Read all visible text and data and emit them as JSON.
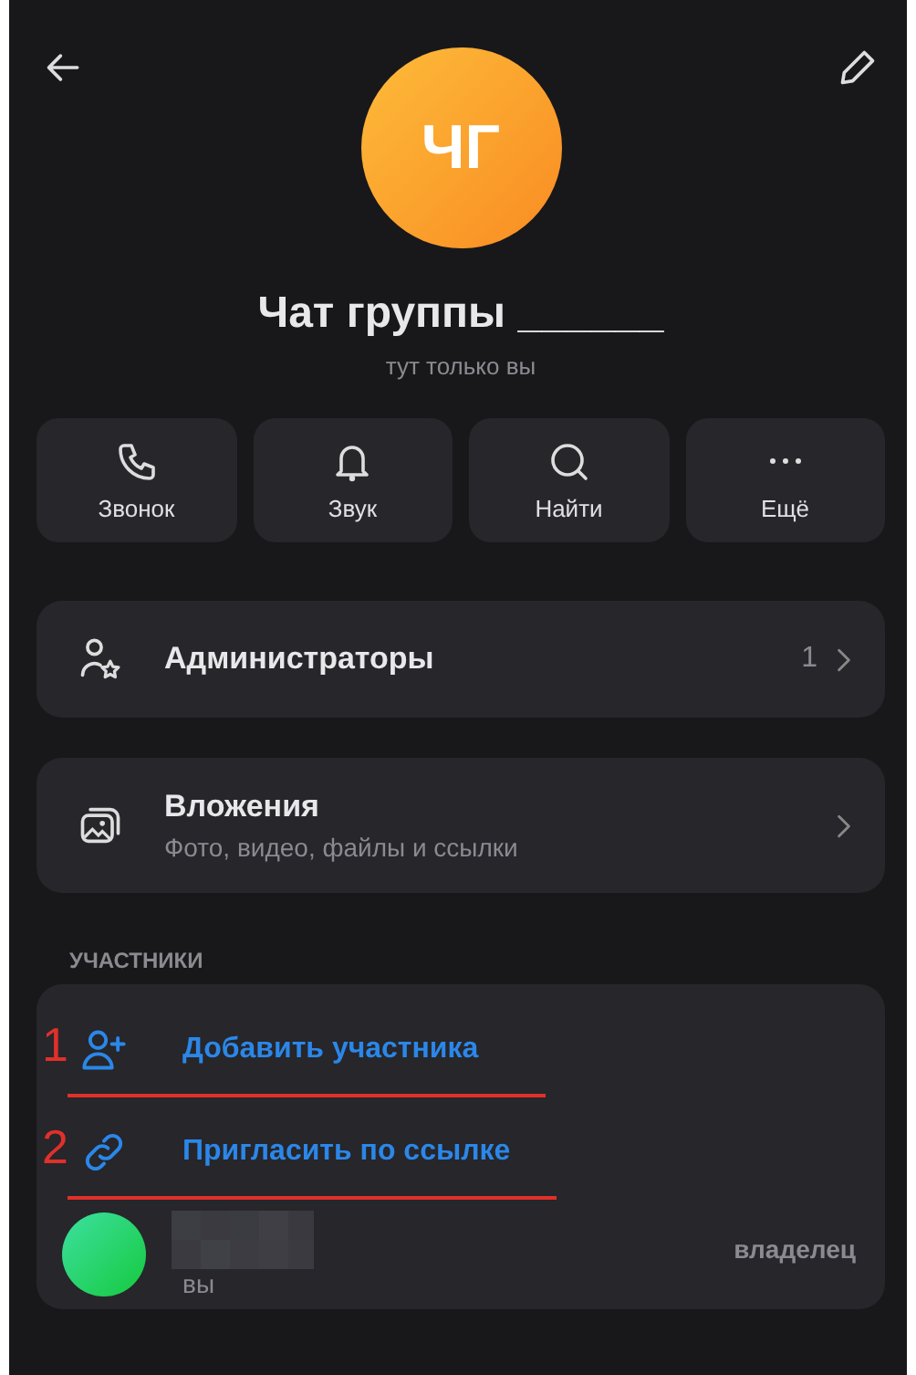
{
  "header": {
    "avatar_initials": "ЧГ",
    "title": "Чат группы ______",
    "subtitle": "тут только вы"
  },
  "actions": [
    {
      "kind": "call",
      "label": "Звонок"
    },
    {
      "kind": "sound",
      "label": "Звук"
    },
    {
      "kind": "search",
      "label": "Найти"
    },
    {
      "kind": "more",
      "label": "Ещё"
    }
  ],
  "menu": [
    {
      "kind": "admins",
      "title": "Администраторы",
      "count": "1"
    },
    {
      "kind": "attachments",
      "title": "Вложения",
      "subtitle": "Фото, видео, файлы и ссылки"
    }
  ],
  "members_section": {
    "heading": "УЧАСТНИКИ",
    "actions": [
      {
        "kind": "add",
        "label": "Добавить участника",
        "annotation": "1"
      },
      {
        "kind": "invite",
        "label": "Пригласить по ссылке",
        "annotation": "2"
      }
    ],
    "members": [
      {
        "subtitle": "вы",
        "role": "владелец"
      }
    ]
  }
}
